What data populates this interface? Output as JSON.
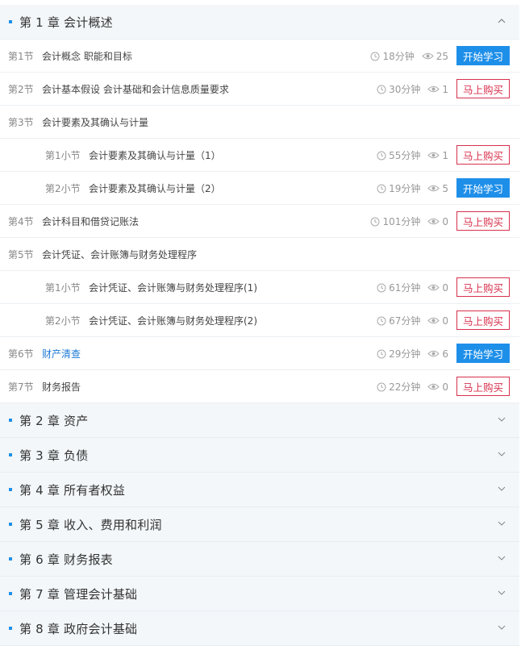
{
  "chapter1": {
    "title": "第 1 章 会计概述",
    "lessons": [
      {
        "num": "第1节",
        "name": "会计概念 职能和目标",
        "duration": "18分钟",
        "views": "25",
        "action": "开始学习",
        "kind": "study"
      },
      {
        "num": "第2节",
        "name": "会计基本假设 会计基础和会计信息质量要求",
        "duration": "30分钟",
        "views": "1",
        "action": "马上购买",
        "kind": "buy"
      },
      {
        "num": "第3节",
        "name": "会计要素及其确认与计量"
      },
      {
        "num": "第1小节",
        "name": "会计要素及其确认与计量（1）",
        "duration": "55分钟",
        "views": "1",
        "action": "马上购买",
        "kind": "buy",
        "sub": true
      },
      {
        "num": "第2小节",
        "name": "会计要素及其确认与计量（2）",
        "duration": "19分钟",
        "views": "5",
        "action": "开始学习",
        "kind": "study",
        "sub": true
      },
      {
        "num": "第4节",
        "name": "会计科目和借贷记账法",
        "duration": "101分钟",
        "views": "0",
        "action": "马上购买",
        "kind": "buy"
      },
      {
        "num": "第5节",
        "name": "会计凭证、会计账簿与财务处理程序"
      },
      {
        "num": "第1小节",
        "name": "会计凭证、会计账簿与财务处理程序(1)",
        "duration": "61分钟",
        "views": "0",
        "action": "马上购买",
        "kind": "buy",
        "sub": true
      },
      {
        "num": "第2小节",
        "name": "会计凭证、会计账簿与财务处理程序(2)",
        "duration": "67分钟",
        "views": "0",
        "action": "马上购买",
        "kind": "buy",
        "sub": true
      },
      {
        "num": "第6节",
        "name": "财产清查",
        "duration": "29分钟",
        "views": "6",
        "action": "开始学习",
        "kind": "study",
        "link": true
      },
      {
        "num": "第7节",
        "name": "财务报告",
        "duration": "22分钟",
        "views": "0",
        "action": "马上购买",
        "kind": "buy"
      }
    ]
  },
  "collapsed_chapters": [
    {
      "title": "第 2 章 资产"
    },
    {
      "title": "第 3 章 负债"
    },
    {
      "title": "第 4 章 所有者权益"
    },
    {
      "title": "第 5 章 收入、费用和利润"
    },
    {
      "title": "第 6 章 财务报表"
    },
    {
      "title": "第 7 章 管理会计基础"
    },
    {
      "title": "第 8 章 政府会计基础"
    }
  ],
  "icons": {
    "expanded": "chevron-up-icon",
    "collapsed": "chevron-down-icon",
    "duration": "clock-icon",
    "views": "eye-icon"
  },
  "colors": {
    "accent": "#1e8fe9",
    "buy": "#d8304d",
    "link": "#1d7ad6",
    "header_bg": "#f3f7fa"
  }
}
